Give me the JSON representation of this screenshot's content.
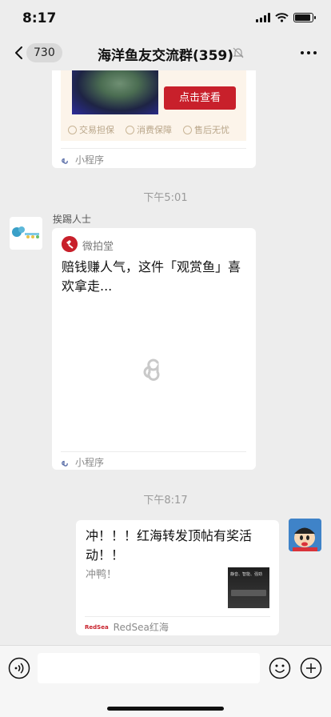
{
  "status_bar": {
    "time": "8:17"
  },
  "header": {
    "unread_count": "730",
    "title": "海洋鱼友交流群(359)"
  },
  "messages": {
    "top_card": {
      "promo_button": "点击查看",
      "guarantees": [
        "交易担保",
        "消费保障",
        "售后无忧"
      ],
      "source": "小程序"
    },
    "time_1": "下午5:01",
    "mini_program": {
      "sender": "挨踢人士",
      "app_name": "微拍堂",
      "text": "赔钱赚人气，这件「观赏鱼」喜欢拿走...",
      "source": "小程序"
    },
    "time_2": "下午8:17",
    "link_card": {
      "title": "冲！！！红海转发顶帖有奖活动！！",
      "description": "冲鸭！",
      "thumbnail_caption": "静音、智能、强劲",
      "source_logo": "RedSea",
      "source": "RedSea红海"
    }
  },
  "colors": {
    "accent_red": "#c8202b",
    "background": "#ededed"
  }
}
